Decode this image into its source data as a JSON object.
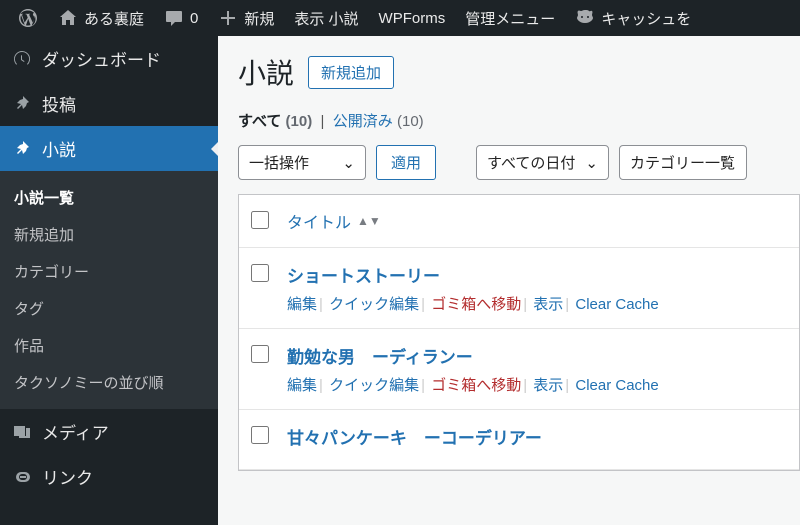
{
  "adminbar": {
    "site_name": "ある裏庭",
    "comments_count": "0",
    "new_label": "新規",
    "view_label": "表示 小説",
    "wpforms": "WPForms",
    "admin_menu": "管理メニュー",
    "cache": "キャッシュを"
  },
  "sidebar": {
    "dashboard": "ダッシュボード",
    "posts": "投稿",
    "novel": "小説",
    "submenu": {
      "list": "小説一覧",
      "add": "新規追加",
      "category": "カテゴリー",
      "tag": "タグ",
      "works": "作品",
      "taxonomy": "タクソノミーの並び順"
    },
    "media": "メディア",
    "links": "リンク"
  },
  "page": {
    "title": "小説",
    "add_new": "新規追加"
  },
  "filters": {
    "all_label": "すべて",
    "all_count": "(10)",
    "published_label": "公開済み",
    "published_count": "(10)"
  },
  "controls": {
    "bulk_action": "一括操作",
    "apply": "適用",
    "all_dates": "すべての日付",
    "category_select": "カテゴリー一覧"
  },
  "table": {
    "title_header": "タイトル",
    "rows": [
      {
        "title": "ショートストーリー",
        "edit": "編集",
        "quick_edit": "クイック編集",
        "trash": "ゴミ箱へ移動",
        "view": "表示",
        "clear_cache": "Clear Cache"
      },
      {
        "title": "勤勉な男　ーディランー",
        "edit": "編集",
        "quick_edit": "クイック編集",
        "trash": "ゴミ箱へ移動",
        "view": "表示",
        "clear_cache": "Clear Cache"
      },
      {
        "title": "甘々パンケーキ　ーコーデリアー"
      }
    ]
  }
}
